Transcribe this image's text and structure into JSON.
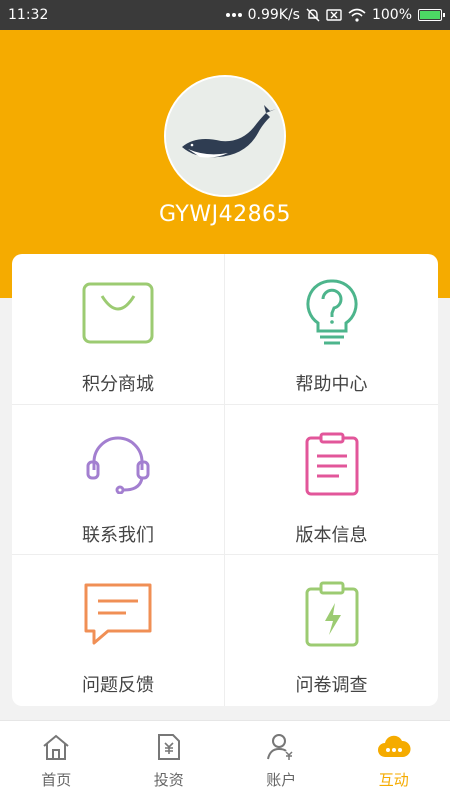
{
  "status_bar": {
    "time": "11:32",
    "network_speed": "0.99K/s",
    "battery_percent": "100%",
    "icons": [
      "dots-icon",
      "bell-muted-icon",
      "close-box-icon",
      "wifi-icon",
      "battery-charging-icon"
    ]
  },
  "profile": {
    "username": "GYWJ42865",
    "avatar_icon": "whale-avatar",
    "header_color": "#f5ab00"
  },
  "menu": {
    "items": [
      {
        "label": "积分商城",
        "icon": "shopping-bag-icon",
        "color": "#9ccb72"
      },
      {
        "label": "帮助中心",
        "icon": "question-bulb-icon",
        "color": "#4db58c"
      },
      {
        "label": "联系我们",
        "icon": "headset-icon",
        "color": "#a37fd0"
      },
      {
        "label": "版本信息",
        "icon": "clipboard-icon",
        "color": "#e2569a"
      },
      {
        "label": "问题反馈",
        "icon": "chat-feedback-icon",
        "color": "#f08f55"
      },
      {
        "label": "问卷调查",
        "icon": "survey-lightning-icon",
        "color": "#9ccb72"
      }
    ]
  },
  "tabbar": {
    "tabs": [
      {
        "label": "首页",
        "icon": "home-icon"
      },
      {
        "label": "投资",
        "icon": "invest-document-icon"
      },
      {
        "label": "账户",
        "icon": "account-user-icon"
      },
      {
        "label": "互动",
        "icon": "interaction-cloud-icon",
        "active": true
      }
    ],
    "active_color": "#f5ab00"
  }
}
